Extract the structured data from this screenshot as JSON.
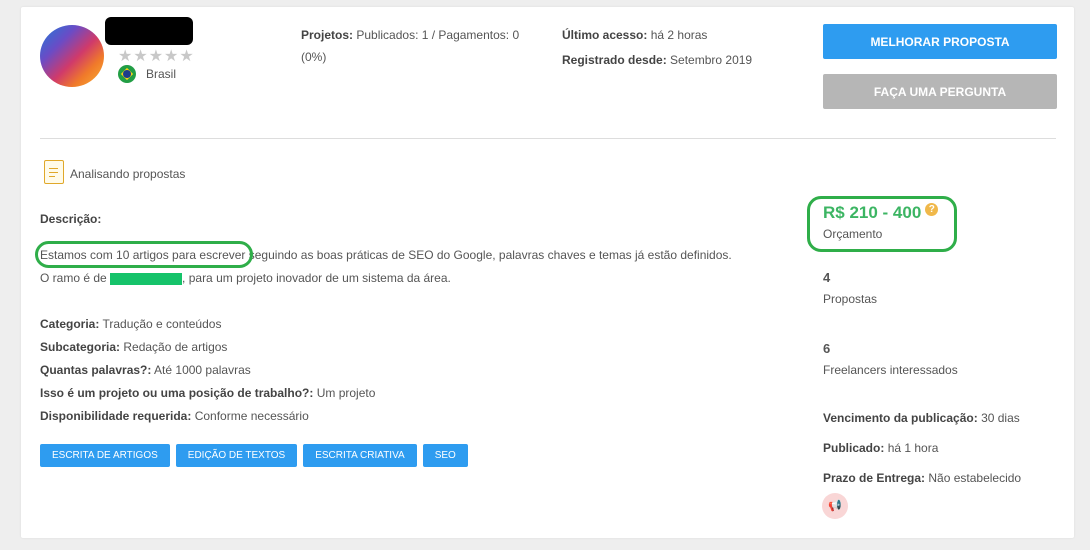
{
  "profile": {
    "country": "Brasil",
    "stars": "★★★★★"
  },
  "stats": {
    "projects_label": "Projetos:",
    "projects_value": "Publicados: 1 / Pagamentos: 0",
    "projects_pct": "(0%)",
    "last_access_label": "Último acesso:",
    "last_access_value": "há 2 horas",
    "registered_label": "Registrado desde:",
    "registered_value": "Setembro 2019"
  },
  "actions": {
    "improve": "MELHORAR PROPOSTA",
    "ask": "FAÇA UMA PERGUNTA"
  },
  "status": "Analisando propostas",
  "description": {
    "label": "Descrição:",
    "line1_highlight": "Estamos com 10 artigos para escrever",
    "line1_rest": " seguindo as boas práticas de SEO do Google, palavras chaves e temas já estão definidos.",
    "line2_start": "O ramo é de",
    "line2_end": ", para um projeto inovador de um sistema da área."
  },
  "details": [
    {
      "label": "Categoria:",
      "value": "Tradução e conteúdos"
    },
    {
      "label": "Subcategoria:",
      "value": "Redação de artigos"
    },
    {
      "label": "Quantas palavras?:",
      "value": "Até 1000 palavras"
    },
    {
      "label": "Isso é um projeto ou uma posição de trabalho?:",
      "value": "Um projeto"
    },
    {
      "label": "Disponibilidade requerida:",
      "value": "Conforme necessário"
    }
  ],
  "tags": [
    "ESCRITA DE ARTIGOS",
    "EDIÇÃO DE TEXTOS",
    "ESCRITA CRIATIVA",
    "SEO"
  ],
  "sidebar": {
    "budget": "R$ 210 - 400",
    "budget_label": "Orçamento",
    "proposals_count": "4",
    "proposals_label": "Propostas",
    "interested_count": "6",
    "interested_label": "Freelancers interessados",
    "expiry_label": "Vencimento da publicação:",
    "expiry_value": "30 dias",
    "published_label": "Publicado:",
    "published_value": "há 1 hora",
    "deadline_label": "Prazo de Entrega:",
    "deadline_value": "Não estabelecido"
  },
  "colors": {
    "primary": "#2e9cf0",
    "secondary": "#b6b6b6",
    "budget_green": "#3cb563",
    "annotation_green": "#2fae49"
  }
}
